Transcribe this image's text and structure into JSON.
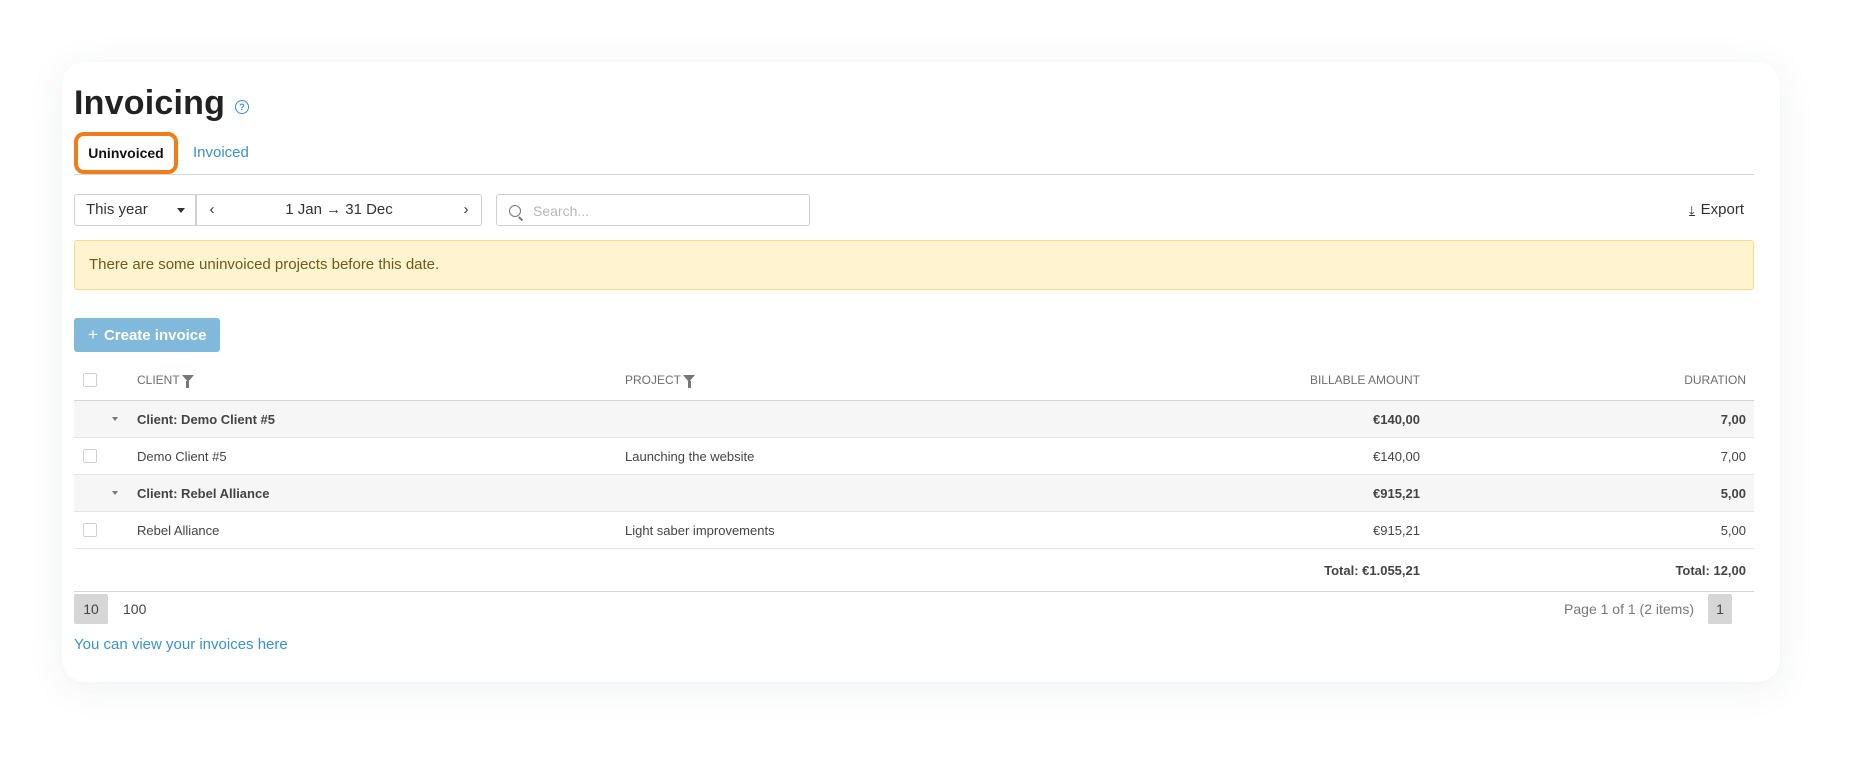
{
  "page": {
    "title": "Invoicing",
    "help_icon": "?"
  },
  "tabs": [
    {
      "label": "Uninvoiced",
      "active": true
    },
    {
      "label": "Invoiced",
      "active": false
    }
  ],
  "toolbar": {
    "period": "This year",
    "range_prev": "‹",
    "range": "1 Jan → 31 Dec",
    "range_next": "›",
    "search_placeholder": "Search...",
    "search_value": "",
    "export_label": "Export",
    "export_icon": "⤓"
  },
  "alert": {
    "text": "There are some uninvoiced projects before this date."
  },
  "create_button": {
    "icon": "+",
    "label": "Create invoice"
  },
  "table": {
    "columns": {
      "client": "CLIENT",
      "project": "PROJECT",
      "amount": "BILLABLE AMOUNT",
      "duration": "DURATION"
    },
    "groups": [
      {
        "label": "Client: Demo Client #5",
        "amount": "€140,00",
        "duration": "7,00",
        "rows": [
          {
            "client": "Demo Client #5",
            "project": "Launching the website",
            "amount": "€140,00",
            "duration": "7,00"
          }
        ]
      },
      {
        "label": "Client: Rebel Alliance",
        "amount": "€915,21",
        "duration": "5,00",
        "rows": [
          {
            "client": "Rebel Alliance",
            "project": "Light saber improvements",
            "amount": "€915,21",
            "duration": "5,00"
          }
        ]
      }
    ],
    "total_amount": "Total: €1.055,21",
    "total_duration": "Total: 12,00"
  },
  "pagination": {
    "sizes": [
      "10",
      "100"
    ],
    "info": "Page 1 of 1 (2 items)",
    "current": "1"
  },
  "link": {
    "text": "You can view your invoices here"
  },
  "colors": {
    "accent": "#3d8fc9",
    "button": "#80b9dc",
    "highlight": "#f07d1a",
    "alert_bg": "#fff4cf"
  }
}
